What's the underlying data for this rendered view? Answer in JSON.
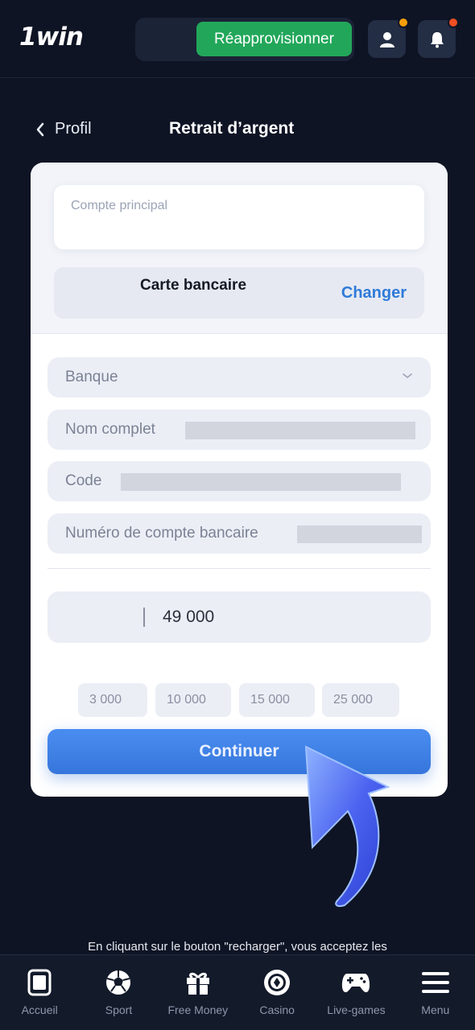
{
  "header": {
    "logo": "1win",
    "topup_label": "Réapprovisionner",
    "user_badge_color": "#f59e0b",
    "bell_badge_color": "#f04e23"
  },
  "nav_title": {
    "back_label": "Profil",
    "title": "Retrait d’argent"
  },
  "card": {
    "account_label": "Compte principal",
    "method_name": "Carte bancaire",
    "change_label": "Changer",
    "fields": {
      "bank": "Banque",
      "full_name": "Nom complet",
      "code": "Code",
      "account_number": "Numéro de compte bancaire"
    },
    "amount": "49 000",
    "quick_amounts": [
      "3 000",
      "10 000",
      "15 000",
      "25 000"
    ],
    "continue_label": "Continuer"
  },
  "terms_text": "En cliquant sur le bouton \"recharger\", vous acceptez les",
  "bottom_nav": {
    "items": [
      {
        "label": "Accueil",
        "icon": "home-icon"
      },
      {
        "label": "Sport",
        "icon": "soccer-ball-icon"
      },
      {
        "label": "Free Money",
        "icon": "gift-icon"
      },
      {
        "label": "Casino",
        "icon": "casino-chip-icon"
      },
      {
        "label": "Live-games",
        "icon": "gamepad-icon"
      },
      {
        "label": "Menu",
        "icon": "menu-icon"
      }
    ]
  },
  "colors": {
    "background": "#0e1424",
    "topup_green": "#22a75a",
    "link_blue": "#2f7ad9",
    "button_blue": "#3d80e6"
  }
}
